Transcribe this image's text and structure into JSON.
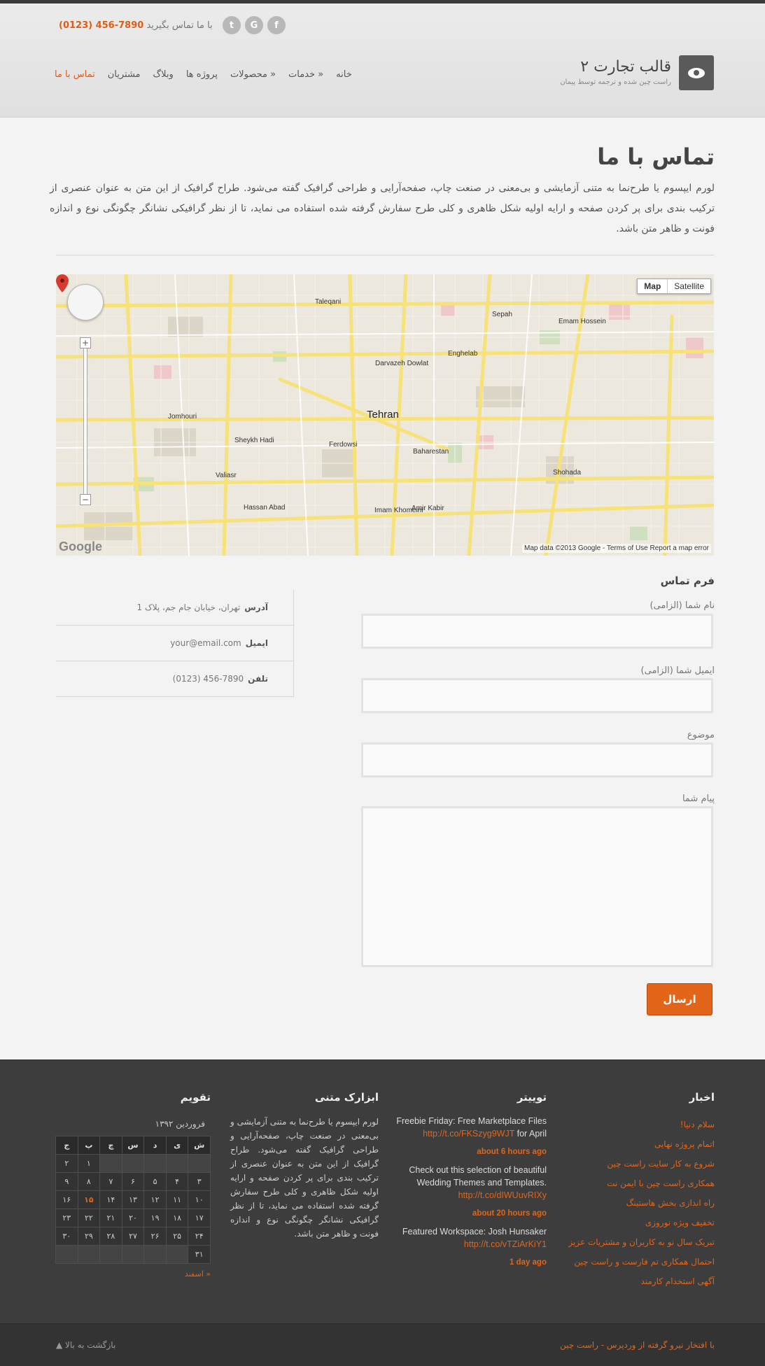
{
  "header": {
    "social": [
      {
        "icon": "facebook-icon",
        "glyph": "f"
      },
      {
        "icon": "google-plus-icon",
        "glyph": "G"
      },
      {
        "icon": "twitter-icon",
        "glyph": "t"
      }
    ],
    "call_label": "با ما تماس بگیرید",
    "phone": "(0123) 456-7890",
    "site_title": "قالب تجارت ۲",
    "site_subtitle": "راست چین شده و ترجمه توسط پیمان",
    "nav": [
      {
        "label": "خانه",
        "active": false
      },
      {
        "label": "خدمات »",
        "active": false
      },
      {
        "label": "محصولات »",
        "active": false
      },
      {
        "label": "پروژه ها",
        "active": false
      },
      {
        "label": "وبلاگ",
        "active": false
      },
      {
        "label": "مشتریان",
        "active": false
      },
      {
        "label": "تماس با ما",
        "active": true
      }
    ]
  },
  "page": {
    "title": "تماس با ما",
    "intro": "لورم ایپسوم یا طرح‌نما به متنی آزمایشی و بی‌معنی در صنعت چاپ، صفحه‌آرایی و طراحی گرافیک گفته می‌شود. طراح گرافیک از این متن به عنوان عنصری از ترکیب بندی برای پر کردن صفحه و ارایه اولیه شکل ظاهری و کلی طرح سفارش گرفته شده استفاده می نماید، تا از نظر گرافیکی نشانگر چگونگی نوع و اندازه فونت و ظاهر متن باشد."
  },
  "map": {
    "type_map": "Map",
    "type_satellite": "Satellite",
    "city_label": "Tehran",
    "footer": "Map data ©2013 Google - Terms of Use  Report a map error",
    "brand": "Google",
    "labels": [
      "Enghelab",
      "Jomhouri",
      "Ferdowsi",
      "Taleqani",
      "Baharestan",
      "Shohada",
      "Imam Khomeini",
      "Amir Kabir",
      "Sheykh Hadi",
      "Valiasr",
      "Hassan Abad",
      "Darvazeh Dowlat",
      "Emam Hossein",
      "Sepah"
    ]
  },
  "contact": {
    "heading": "فرم تماس",
    "info": [
      {
        "label": "آدرس",
        "value": "تهران، خیابان جام جم، پلاک 1"
      },
      {
        "label": "ایمیل",
        "value": "your@email.com"
      },
      {
        "label": "تلفن",
        "value": "(0123) 456-7890"
      }
    ],
    "fields": [
      {
        "label": "نام شما (الزامی)"
      },
      {
        "label": "ایمیل شما (الزامی)"
      },
      {
        "label": "موضوع"
      },
      {
        "label": "پیام شما"
      }
    ],
    "submit": "ارسال"
  },
  "footer": {
    "news_title": "اخبار",
    "news": [
      "سلام دنیا!",
      "اتمام پروژه نهایی",
      "شروع به کار سایت راست چین",
      "همکاری راست چین با ایمن نت",
      "راه اندازی بخش هاستینگ",
      "تخفیف ویژه نوروزی",
      "تبریک سال نو به کاربران و مشتریات عزیز",
      "احتمال همکاری تم فارست و راست چین",
      "آگهی استخدام کارمند"
    ],
    "twitter_title": "توییتر",
    "tweets": [
      {
        "text": "Freebie Friday: Free Marketplace Files",
        "link": "http://t.co/FKSzyg9WJT",
        "after": "for April",
        "time": "about 6 hours ago"
      },
      {
        "text": "Check out this selection of beautiful Wedding Themes and Templates.",
        "link": "http://t.co/dIWUuvRIXy",
        "after": "",
        "time": "about 20 hours ago"
      },
      {
        "text": "Featured Workspace: Josh Hunsaker",
        "link": "http://t.co/vTZiArKiY1",
        "after": "",
        "time": "1 day ago"
      }
    ],
    "text_title": "ابزارک متنی",
    "text_body": "لورم ایپسوم یا طرح‌نما به متنی آزمایشی و بی‌معنی در صنعت چاپ، صفحه‌آرایی و طراحی گرافیک گفته می‌شود. طراح گرافیک از این متن به عنوان عنصری از ترکیب بندی برای پر کردن صفحه و ارایه اولیه شکل ظاهری و کلی طرح سفارش گرفته شده استفاده می نماید، تا از نظر گرافیکی نشانگر چگونگی نوع و اندازه فونت و ظاهر متن باشد.",
    "calendar_title": "تقویم",
    "calendar": {
      "caption": "فروردین ۱۳۹۲",
      "weekdays": [
        "ش",
        "ی",
        "د",
        "س",
        "چ",
        "پ",
        "ج"
      ],
      "weeks": [
        [
          "",
          "",
          "",
          "",
          "",
          "۱",
          "۲"
        ],
        [
          "۳",
          "۴",
          "۵",
          "۶",
          "۷",
          "۸",
          "۹"
        ],
        [
          "۱۰",
          "۱۱",
          "۱۲",
          "۱۳",
          "۱۴",
          "۱۵",
          "۱۶"
        ],
        [
          "۱۷",
          "۱۸",
          "۱۹",
          "۲۰",
          "۲۱",
          "۲۲",
          "۲۳"
        ],
        [
          "۲۴",
          "۲۵",
          "۲۶",
          "۲۷",
          "۲۸",
          "۲۹",
          "۳۰"
        ],
        [
          "۳۱",
          "",
          "",
          "",
          "",
          "",
          ""
        ]
      ],
      "today": "۱۵",
      "prev_link": "« اسفند"
    }
  },
  "bottom": {
    "credit": "با افتخار نیرو گرفته از وردپرس - راست چین",
    "back_to_top": "بازگشت به بالا ▲"
  }
}
